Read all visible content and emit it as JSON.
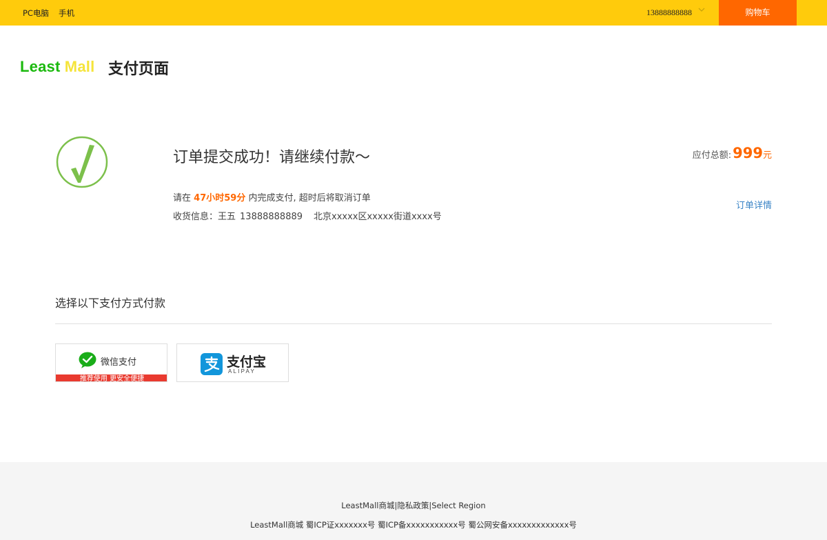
{
  "topbar": {
    "links": [
      "PC电脑",
      "手机"
    ],
    "user": "13888888888",
    "cart_label": "购物车"
  },
  "header": {
    "logo_part1": "Least",
    "logo_part2": "Mall",
    "title": "支付页面"
  },
  "order": {
    "status_title": "订单提交成功！请继续付款～",
    "countdown_prefix": "请在",
    "countdown_time": "47小时59分",
    "countdown_suffix": "内完成支付, 超时后将取消订单",
    "receiver_label": "收货信息：",
    "receiver_name": "王五",
    "receiver_phone": "13888888889",
    "receiver_address": "北京xxxxx区xxxxx街道xxxx号",
    "amount_label": "应付总额:",
    "amount_value": "999",
    "amount_unit": "元",
    "detail_link": "订单详情"
  },
  "payment": {
    "heading": "选择以下支付方式付款",
    "methods": [
      {
        "label": "微信支付",
        "badge": "推荐使用 更安全便捷"
      },
      {
        "label": "支付宝",
        "sub": "ALIPAY"
      }
    ]
  },
  "footer": {
    "links": [
      "LeastMall商城",
      "隐私政策",
      "Select Region"
    ],
    "separator": "|",
    "icp": "LeastMall商城 蜀ICP证xxxxxxx号 蜀ICP备xxxxxxxxxxx号 蜀公网安备xxxxxxxxxxxxx号"
  },
  "colors": {
    "topbar": "#ffcb0c",
    "cart": "#ff6700",
    "accent": "#ff6700",
    "link": "#3a84c6",
    "check": "#7cc04b"
  }
}
